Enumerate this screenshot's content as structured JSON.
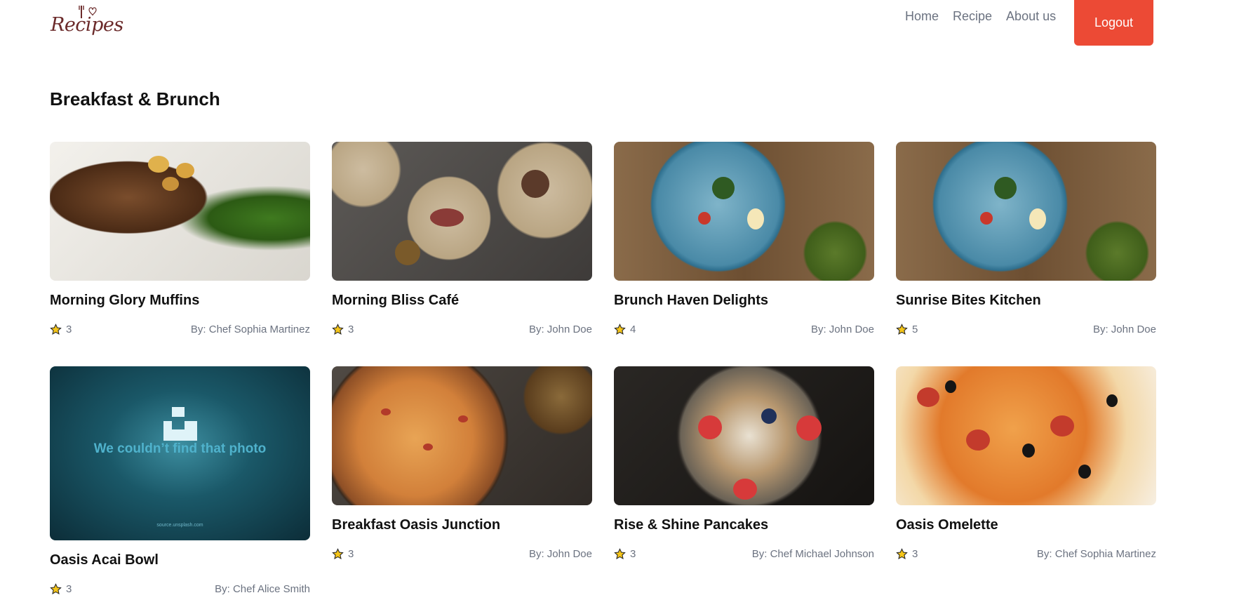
{
  "header": {
    "logo_text": "Recipes",
    "nav": [
      "Home",
      "Recipe",
      "About us"
    ],
    "logout_label": "Logout"
  },
  "section": {
    "title": "Breakfast & Brunch"
  },
  "colors": {
    "accent": "#ec4a35",
    "star": "#f5c518",
    "muted": "#6b7280"
  },
  "recipes": [
    {
      "title": "Morning Glory Muffins",
      "rating": "3",
      "author": "By: Chef Sophia Martinez",
      "image": "steak"
    },
    {
      "title": "Morning Bliss Café",
      "rating": "3",
      "author": "By: John Doe",
      "image": "salad"
    },
    {
      "title": "Brunch Haven Delights",
      "rating": "4",
      "author": "By: John Doe",
      "image": "plate"
    },
    {
      "title": "Sunrise Bites Kitchen",
      "rating": "5",
      "author": "By: John Doe",
      "image": "plate"
    },
    {
      "title": "Oasis Acai Bowl",
      "rating": "3",
      "author": "By: Chef Alice Smith",
      "image": "placeholder",
      "image_text": "We couldn’t find that photo",
      "image_subtext": "source.unsplash.com"
    },
    {
      "title": "Breakfast Oasis Junction",
      "rating": "3",
      "author": "By: John Doe",
      "image": "pizza"
    },
    {
      "title": "Rise & Shine Pancakes",
      "rating": "3",
      "author": "By: Chef Michael Johnson",
      "image": "pancake"
    },
    {
      "title": "Oasis Omelette",
      "rating": "3",
      "author": "By: Chef Sophia Martinez",
      "image": "pizza2"
    }
  ]
}
